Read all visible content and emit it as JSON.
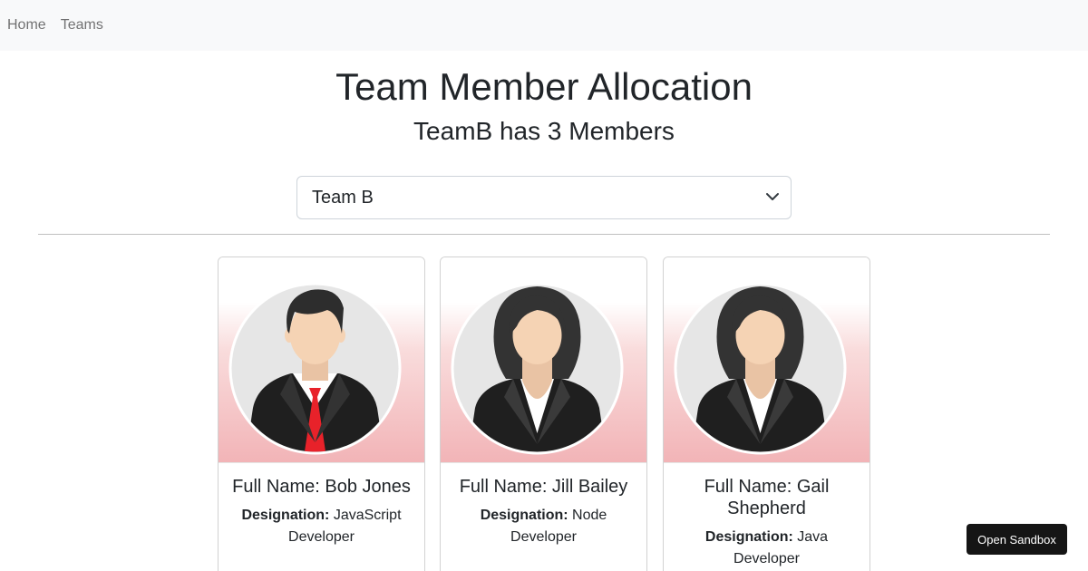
{
  "nav": {
    "items": [
      {
        "label": "Home"
      },
      {
        "label": "Teams"
      }
    ]
  },
  "header": {
    "title": "Team Member Allocation",
    "subtitle": "TeamB has 3 Members"
  },
  "team_select": {
    "selected": "Team B"
  },
  "members": [
    {
      "name_label": "Full Name: Bob Jones",
      "designation_label": "Designation:",
      "designation": "JavaScript Developer",
      "avatar": "male-avatar-icon"
    },
    {
      "name_label": "Full Name: Jill Bailey",
      "designation_label": "Designation:",
      "designation": "Node Developer",
      "avatar": "female-avatar-icon"
    },
    {
      "name_label": "Full Name: Gail Shepherd",
      "designation_label": "Designation:",
      "designation": "Java Developer",
      "avatar": "female-avatar-icon"
    }
  ],
  "sandbox": {
    "label": "Open Sandbox"
  },
  "colors": {
    "navbar_bg": "#f8f9fa",
    "card_gradient_bottom": "#f2b4b7",
    "sandbox_bg": "#151515",
    "tie": "#e8222a"
  }
}
